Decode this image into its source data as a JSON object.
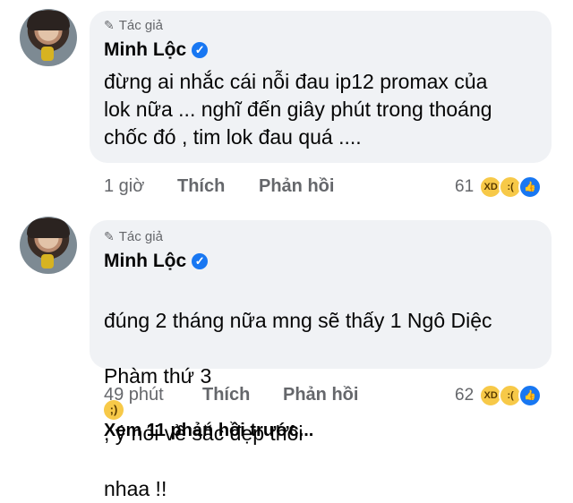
{
  "comments": [
    {
      "author_tag": "Tác giả",
      "author_name": "Minh Lộc",
      "text": "đừng ai nhắc cái nỗi đau ip12 promax của\nlok nữa ... nghĩ đến giây phút trong thoáng\nchốc đó , tim lok đau quá ....",
      "time": "1 giờ",
      "like_label": "Thích",
      "reply_label": "Phản hồi",
      "reaction_count": "61",
      "reactions": [
        "haha-icon",
        "sad-icon",
        "like-icon"
      ]
    },
    {
      "author_tag": "Tác giả",
      "author_name": "Minh Lộc",
      "text_line1": "đúng 2 tháng nữa mng sẽ thấy 1 Ngô Diệc",
      "text_line2a": "Phàm thứ 3",
      "text_line2b": ", ý nói về sắc đẹp thôi",
      "text_line3": "nhaa !!",
      "emoji": "wink-emoji",
      "time": "49 phút",
      "like_label": "Thích",
      "reply_label": "Phản hồi",
      "reaction_count": "62",
      "reactions": [
        "haha-icon",
        "sad-icon",
        "like-icon"
      ]
    }
  ],
  "view_more": "Xem 11 phản hồi trước...",
  "colors": {
    "bubble": "#f0f2f5",
    "meta": "#65676b",
    "verified": "#1877f2"
  }
}
